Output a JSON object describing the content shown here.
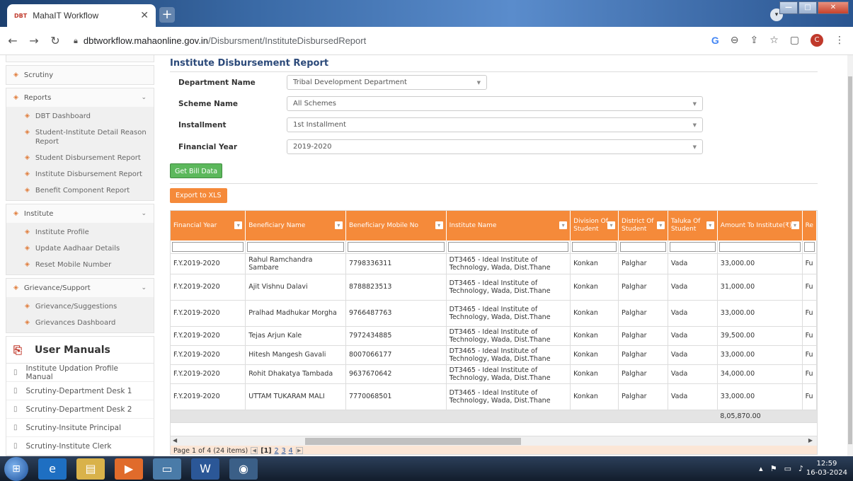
{
  "browser": {
    "tab_title": "MahaIT Workflow",
    "tab_favicon": "DBT",
    "url_host": "dbtworkflow.mahaonline.gov.in",
    "url_path": "/Disbursment/InstituteDisbursedReport",
    "profile_initial": "C"
  },
  "sidebar": {
    "scrutiny": "Scrutiny",
    "reports": {
      "label": "Reports",
      "items": [
        "DBT Dashboard",
        "Student-Institute Detail Reason Report",
        "Student Disbursement Report",
        "Institute Disbursement Report",
        "Benefit Component Report"
      ]
    },
    "institute": {
      "label": "Institute",
      "items": [
        "Institute Profile",
        "Update Aadhaar Details",
        "Reset Mobile Number"
      ]
    },
    "grievance": {
      "label": "Grievance/Support",
      "items": [
        "Grievance/Suggestions",
        "Grievances Dashboard"
      ]
    },
    "manuals": {
      "title": "User Manuals",
      "items": [
        "Institute Updation Profile Manual",
        "Scrutiny-Department Desk 1",
        "Scrutiny-Department Desk 2",
        "Scrutiny-Insitute Principal",
        "Scrutiny-Institute Clerk"
      ]
    }
  },
  "main": {
    "title": "Institute Disbursement Report",
    "form": {
      "department_label": "Department Name",
      "department_value": "Tribal Development Department",
      "scheme_label": "Scheme Name",
      "scheme_value": "All Schemes",
      "installment_label": "Installment",
      "installment_value": "1st Installment",
      "year_label": "Financial Year",
      "year_value": "2019-2020"
    },
    "get_bill_label": "Get Bill Data",
    "export_label": "Export to XLS",
    "table": {
      "headers": [
        "Financial Year",
        "Beneficiary Name",
        "Beneficiary Mobile No",
        "Institute Name",
        "Division Of Student",
        "District Of Student",
        "Taluka Of Student",
        "Amount To Institute(₹)",
        "Re"
      ],
      "rows": [
        [
          "F.Y.2019-2020",
          "Rahul Ramchandra Sambare",
          "7798336311",
          "DT3465 - Ideal Institute of Technology, Wada, Dist.Thane",
          "Konkan",
          "Palghar",
          "Vada",
          "33,000.00",
          "Fu"
        ],
        [
          "F.Y.2019-2020",
          "Ajit Vishnu Dalavi",
          "8788823513",
          "DT3465 - Ideal Institute of Technology, Wada, Dist.Thane",
          "Konkan",
          "Palghar",
          "Vada",
          "31,000.00",
          "Fu"
        ],
        [
          "F.Y.2019-2020",
          "Pralhad Madhukar Morgha",
          "9766487763",
          "DT3465 - Ideal Institute of Technology, Wada, Dist.Thane",
          "Konkan",
          "Palghar",
          "Vada",
          "33,000.00",
          "Fu"
        ],
        [
          "F.Y.2019-2020",
          "Tejas Arjun Kale",
          "7972434885",
          "DT3465 - Ideal Institute of Technology, Wada, Dist.Thane",
          "Konkan",
          "Palghar",
          "Vada",
          "39,500.00",
          "Fu"
        ],
        [
          "F.Y.2019-2020",
          "Hitesh Mangesh Gavali",
          "8007066177",
          "DT3465 - Ideal Institute of Technology, Wada, Dist.Thane",
          "Konkan",
          "Palghar",
          "Vada",
          "33,000.00",
          "Fu"
        ],
        [
          "F.Y.2019-2020",
          "Rohit Dhakatya Tambada",
          "9637670642",
          "DT3465 - Ideal Institute of Technology, Wada, Dist.Thane",
          "Konkan",
          "Palghar",
          "Vada",
          "34,000.00",
          "Fu"
        ],
        [
          "F.Y.2019-2020",
          "UTTAM TUKARAM MALI",
          "7770068501",
          "DT3465 - Ideal Institute of Technology, Wada, Dist.Thane",
          "Konkan",
          "Palghar",
          "Vada",
          "33,000.00",
          "Fu"
        ]
      ],
      "total": "8,05,870.00"
    },
    "pager": {
      "summary": "Page 1 of 4 (24 items)",
      "current": "[1]",
      "pages": [
        "2",
        "3",
        "4"
      ]
    }
  },
  "taskbar": {
    "time": "12:59",
    "date": "16-03-2024"
  },
  "colors": {
    "accent_orange": "#f58a3a",
    "button_green": "#5cb85c",
    "title_blue": "#2c4a7a"
  }
}
